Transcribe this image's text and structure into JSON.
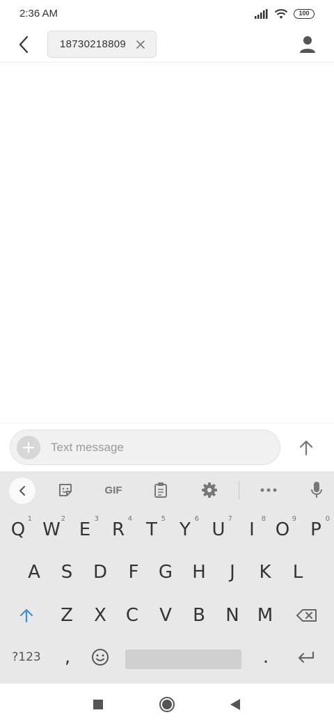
{
  "status": {
    "time": "2:36 AM",
    "battery": "100"
  },
  "header": {
    "recipient": "18730218809",
    "icons": {
      "back": "back-arrow-icon",
      "close": "close-icon",
      "contact": "person-icon"
    }
  },
  "compose": {
    "placeholder": "Text message",
    "icons": {
      "add": "plus-icon",
      "send": "send-arrow-icon"
    }
  },
  "keyboard": {
    "toolbar": {
      "gif_label": "GIF",
      "icons": [
        "collapse-icon",
        "sticker-icon",
        "clipboard-icon",
        "gear-icon",
        "more-icon",
        "mic-icon"
      ]
    },
    "row1": [
      {
        "label": "Q",
        "hint": "1"
      },
      {
        "label": "W",
        "hint": "2"
      },
      {
        "label": "E",
        "hint": "3"
      },
      {
        "label": "R",
        "hint": "4"
      },
      {
        "label": "T",
        "hint": "5"
      },
      {
        "label": "Y",
        "hint": "6"
      },
      {
        "label": "U",
        "hint": "7"
      },
      {
        "label": "I",
        "hint": "8"
      },
      {
        "label": "O",
        "hint": "9"
      },
      {
        "label": "P",
        "hint": "0"
      }
    ],
    "row2": [
      "A",
      "S",
      "D",
      "F",
      "G",
      "H",
      "J",
      "K",
      "L"
    ],
    "row3": [
      "Z",
      "X",
      "C",
      "V",
      "B",
      "N",
      "M"
    ],
    "row4": {
      "symbols": "?123",
      "comma": ",",
      "period": "."
    },
    "accent_color": "#3d8fd6"
  },
  "nav": {
    "icons": [
      "recents-square-icon",
      "home-circle-icon",
      "back-triangle-icon"
    ]
  }
}
